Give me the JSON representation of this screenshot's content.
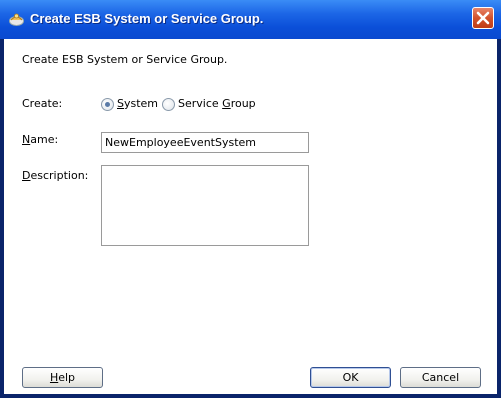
{
  "window": {
    "title": "Create ESB System or Service Group.",
    "icon": "oracle-jdeveloper-icon",
    "close_icon": "close-x-icon"
  },
  "dialog": {
    "intro_text": "Create ESB System or Service Group.",
    "create_label": "Create:",
    "create_options": [
      {
        "label_mnemonic": "S",
        "label_rest": "ystem",
        "selected": true
      },
      {
        "label_prefix": "Service ",
        "label_mnemonic": "G",
        "label_rest": "roup",
        "selected": false
      }
    ],
    "name_label_mnemonic": "N",
    "name_label_rest": "ame:",
    "name_value": "NewEmployeeEventSystem",
    "description_label_mnemonic": "D",
    "description_label_rest": "escription:",
    "description_value": ""
  },
  "buttons": {
    "help_mnemonic": "H",
    "help_rest": "elp",
    "ok": "OK",
    "cancel": "Cancel"
  },
  "colors": {
    "titlebar": "#0a4ad0",
    "close_button": "#d2522c",
    "client_bg": "#ffffff"
  }
}
